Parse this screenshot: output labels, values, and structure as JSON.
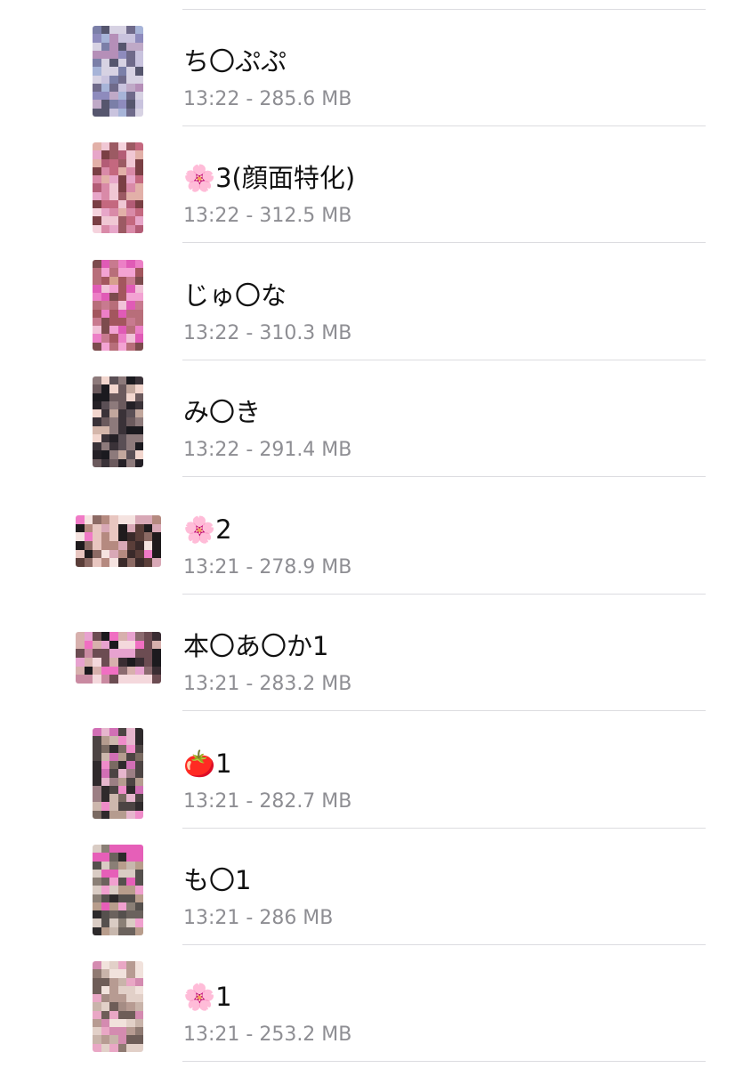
{
  "files": [
    {
      "name": "ち〇ぷぷ",
      "meta": "13:22 - 285.6 MB",
      "thumb": "portrait",
      "palette": [
        "#7b7fa8",
        "#c9c3de",
        "#8e8bbd",
        "#bfa9c7",
        "#56566e",
        "#a7b4d8",
        "#d7d2e3",
        "#6f6a8a",
        "#b58fb8"
      ]
    },
    {
      "name": "🌸3(顔面特化)",
      "meta": "13:22 - 312.5 MB",
      "thumb": "portrait",
      "palette": [
        "#e7a6c9",
        "#c4687f",
        "#f0c7d4",
        "#d98aa8",
        "#7a3f44",
        "#f5d3dd",
        "#b35c76",
        "#e2b0a8",
        "#9c5a63"
      ]
    },
    {
      "name": "じゅ〇な",
      "meta": "13:22 - 310.3 MB",
      "thumb": "portrait",
      "palette": [
        "#e05bb6",
        "#c87a8f",
        "#f3a3d3",
        "#a3565e",
        "#d6a08d",
        "#ec7fc6",
        "#7c4b4d",
        "#f1c2d8",
        "#b86e7a"
      ]
    },
    {
      "name": "み〇き",
      "meta": "13:22 - 291.4 MB",
      "thumb": "portrait",
      "palette": [
        "#1b1a1f",
        "#3a3238",
        "#c2a79d",
        "#5a4f55",
        "#8d7a7b",
        "#242026",
        "#d4b6aa",
        "#6b5a5d",
        "#f2d6ce"
      ]
    },
    {
      "name": "🌸2",
      "meta": "13:21 - 278.9 MB",
      "thumb": "landscape",
      "palette": [
        "#5a3e39",
        "#e8c6c0",
        "#1f1b1d",
        "#f07ac6",
        "#b58a80",
        "#8c6a64",
        "#f5e3e0",
        "#d8a8b6",
        "#3a2a2a"
      ]
    },
    {
      "name": "本〇あ〇か1",
      "meta": "13:21 - 283.2 MB",
      "thumb": "landscape",
      "palette": [
        "#3a2d33",
        "#f06fc2",
        "#d7b0ad",
        "#1c1a1e",
        "#e7a2cf",
        "#8b6a6f",
        "#f4d8dc",
        "#6c4c52",
        "#c98aa1"
      ]
    },
    {
      "name": "🍅1",
      "meta": "13:21 - 282.7 MB",
      "thumb": "portrait",
      "palette": [
        "#d16fb5",
        "#7a6a62",
        "#e6b6cd",
        "#4c4443",
        "#b59c8f",
        "#ef8cc9",
        "#2f2a2c",
        "#cdb7ad",
        "#9c7f84"
      ]
    },
    {
      "name": "も〇1",
      "meta": "13:21 - 286 MB",
      "thumb": "portrait",
      "palette": [
        "#8a7f76",
        "#2d2a2b",
        "#e65fb8",
        "#c7b7ad",
        "#55504d",
        "#b89d8c",
        "#f0a0cf",
        "#6b625d",
        "#d9ccc4"
      ]
    },
    {
      "name": "🌸1",
      "meta": "13:21 - 253.2 MB",
      "thumb": "portrait",
      "palette": [
        "#c9b4aa",
        "#8f7a72",
        "#e9a7c5",
        "#b79b92",
        "#e2d0c8",
        "#6e5d58",
        "#d48bb0",
        "#f1e2dc",
        "#a58c84"
      ]
    }
  ]
}
